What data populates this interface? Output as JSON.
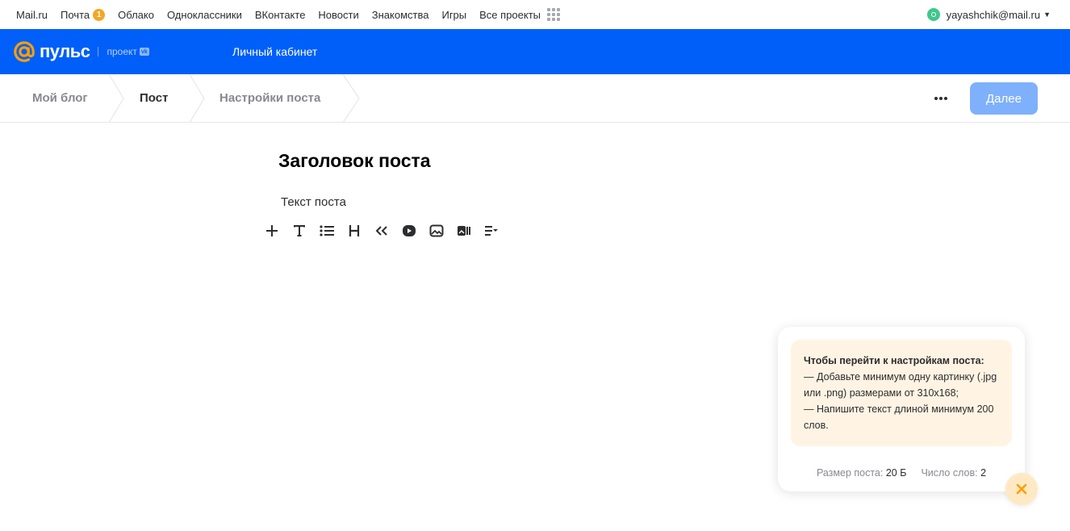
{
  "portal": {
    "links": [
      "Mail.ru",
      "Почта",
      "Облако",
      "Одноклассники",
      "ВКонтакте",
      "Новости",
      "Знакомства",
      "Игры",
      "Все проекты"
    ],
    "mail_badge": "1",
    "user_email": "yayashchik@mail.ru"
  },
  "header": {
    "logo_text": "пульс",
    "project_label": "проект",
    "cabinet_link": "Личный кабинет"
  },
  "steps": {
    "items": [
      "Мой блог",
      "Пост",
      "Настройки поста"
    ],
    "active": "Пост",
    "next_label": "Далее"
  },
  "editor": {
    "title": "Заголовок поста",
    "text": "Текст поста",
    "toolbar_icons": [
      "plus-icon",
      "text-icon",
      "list-icon",
      "heading-icon",
      "quote-icon",
      "video-icon",
      "image-icon",
      "gallery-icon",
      "align-icon"
    ]
  },
  "hint": {
    "title": "Чтобы перейти к настройкам поста:",
    "line1": "— Добавьте минимум одну картинку (.jpg или .png) размерами от 310x168;",
    "line2": "— Напишите текст длиной минимум 200 слов.",
    "size_label": "Размер поста:",
    "size_value": "20 Б",
    "words_label": "Число слов:",
    "words_value": "2"
  },
  "colors": {
    "header_blue": "#005ff9",
    "accent_orange": "#ff9e00",
    "next_button": "#7fb0fc",
    "hint_bg": "#fff4e3"
  }
}
